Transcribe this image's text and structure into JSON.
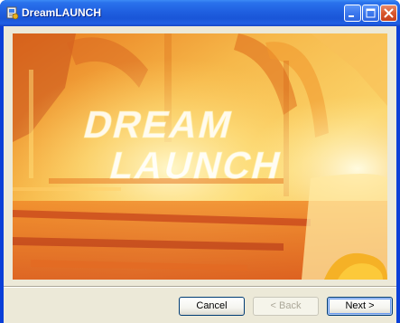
{
  "window": {
    "title": "DreamLAUNCH"
  },
  "splash": {
    "line1": "DREAM",
    "line2": "LAUNCH"
  },
  "buttons": {
    "cancel": "Cancel",
    "back": "< Back",
    "next": "Next >"
  },
  "colors": {
    "titlebar": "#1f5fe0",
    "dialog_bg": "#ece9d8",
    "splash_orange": "#f2a23a",
    "splash_yellow": "#ffe45a"
  }
}
